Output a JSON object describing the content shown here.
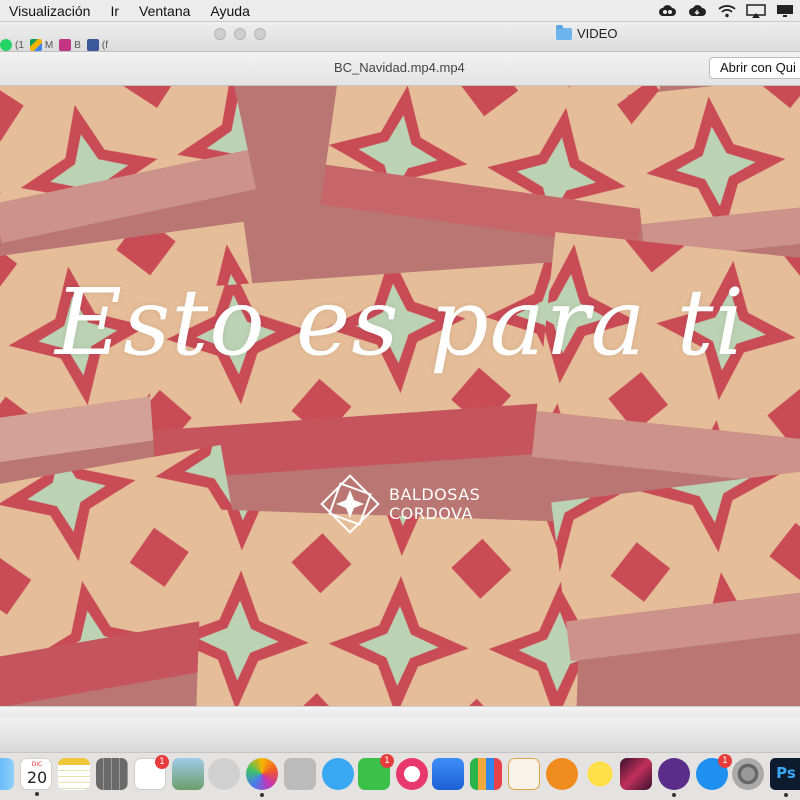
{
  "menubar": {
    "items": [
      "Visualización",
      "Ir",
      "Ventana",
      "Ayuda"
    ],
    "status_icons": [
      "creative-cloud-icon",
      "cloud-sync-icon",
      "wifi-icon",
      "airplay-icon",
      "screen-mirroring-icon"
    ]
  },
  "finder": {
    "title": "VIDEO",
    "browser_tabs": [
      {
        "icon": "whatsapp-icon",
        "label": "(1",
        "color": "#25d366"
      },
      {
        "icon": "google-drive-icon",
        "label": "M",
        "color": "#f4b400"
      },
      {
        "icon": "instagram-icon",
        "label": "B",
        "color": "#c13584"
      },
      {
        "icon": "facebook-icon",
        "label": "(f",
        "color": "#3b5998"
      }
    ]
  },
  "quicklook": {
    "file_title": "BC_Navidad.mp4.mp4",
    "open_with_label": "Abrir con Qui"
  },
  "video": {
    "headline": "Esto es para ti",
    "brand_line1": "BALDOSAS",
    "brand_line2": "CORDOVA",
    "colors": {
      "tile_red": "#c43c48",
      "tile_green": "#b7cfae",
      "tile_beige": "#e3b890",
      "tile_edge": "#c98a80"
    }
  },
  "dock": {
    "calendar_month": "DIC",
    "calendar_day": "20",
    "photoshop_label": "Ps",
    "badges": {
      "reminders": "1",
      "facetime": "1",
      "appstore": "1"
    },
    "apps": [
      "finder-partial-icon",
      "calendar-icon",
      "notes-icon",
      "calculator-icon",
      "reminders-icon",
      "preview-icon",
      "screenshot-icon",
      "photos-icon",
      "photo-booth-icon",
      "messages-icon",
      "facetime-icon",
      "itunes-icon",
      "keynote-icon",
      "numbers-icon",
      "pages-icon",
      "ibooks-icon",
      "cyberduck-icon",
      "dvd-player-icon",
      "imovie-icon",
      "app-store-icon",
      "system-preferences-icon",
      "photoshop-icon"
    ]
  }
}
